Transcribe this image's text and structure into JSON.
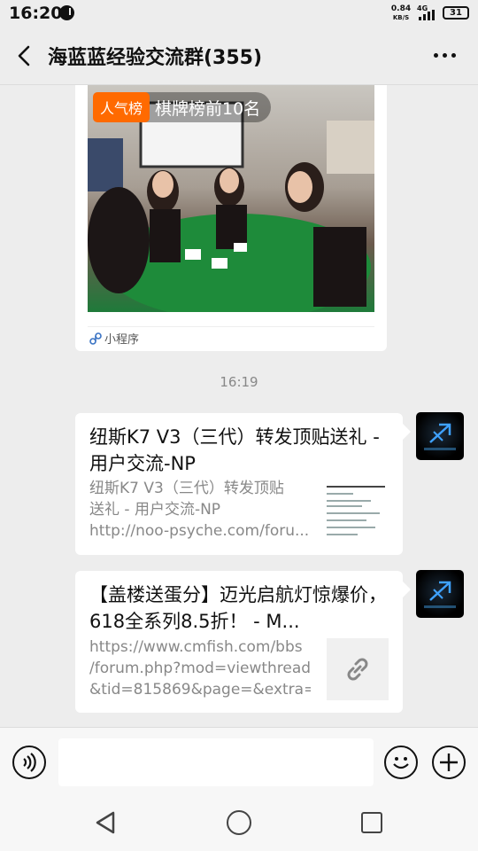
{
  "status_bar": {
    "time": "16:20",
    "net_speed_value": "0.84",
    "net_speed_unit": "KB/S",
    "network_type": "4G",
    "battery": "31",
    "icons": [
      "notification-icon",
      "signal-icon",
      "battery-icon"
    ]
  },
  "header": {
    "title": "海蓝蓝经验交流群(355)",
    "back_icon": "chevron-left-icon",
    "more_icon": "more-dots-icon"
  },
  "messages": {
    "mini_program": {
      "badge_tag": "人气榜",
      "badge_text": "棋牌榜前10名",
      "footer_label": "小程序",
      "footer_icon": "mini-program-icon"
    },
    "time_divider": "16:19",
    "link1": {
      "title": "纽斯K7 V3（三代）转发顶贴送礼 - 用户交流-NP",
      "desc_line1": "纽斯K7 V3（三代）转发顶贴",
      "desc_line2": "送礼 - 用户交流-NP",
      "desc_line3": "http://noo-psyche.com/foru..."
    },
    "link2": {
      "title": "【盖楼送蛋分】迈光启航灯惊爆价，618全系列8.5折！ - M...",
      "desc_line1": "https://www.cmfish.com/bbs",
      "desc_line2": "/forum.php?mod=viewthread",
      "desc_line3": "&tid=815869&page=&extra=..."
    }
  },
  "input_bar": {
    "placeholder": "",
    "icons": [
      "voice-icon",
      "emoji-icon",
      "plus-icon"
    ]
  },
  "system_nav": {
    "icons": [
      "nav-back-icon",
      "nav-home-icon",
      "nav-recents-icon"
    ]
  },
  "colors": {
    "background": "#ededed",
    "bubble": "#ffffff",
    "badge_orange": "#ff6a00",
    "secondary_text": "#888888"
  }
}
